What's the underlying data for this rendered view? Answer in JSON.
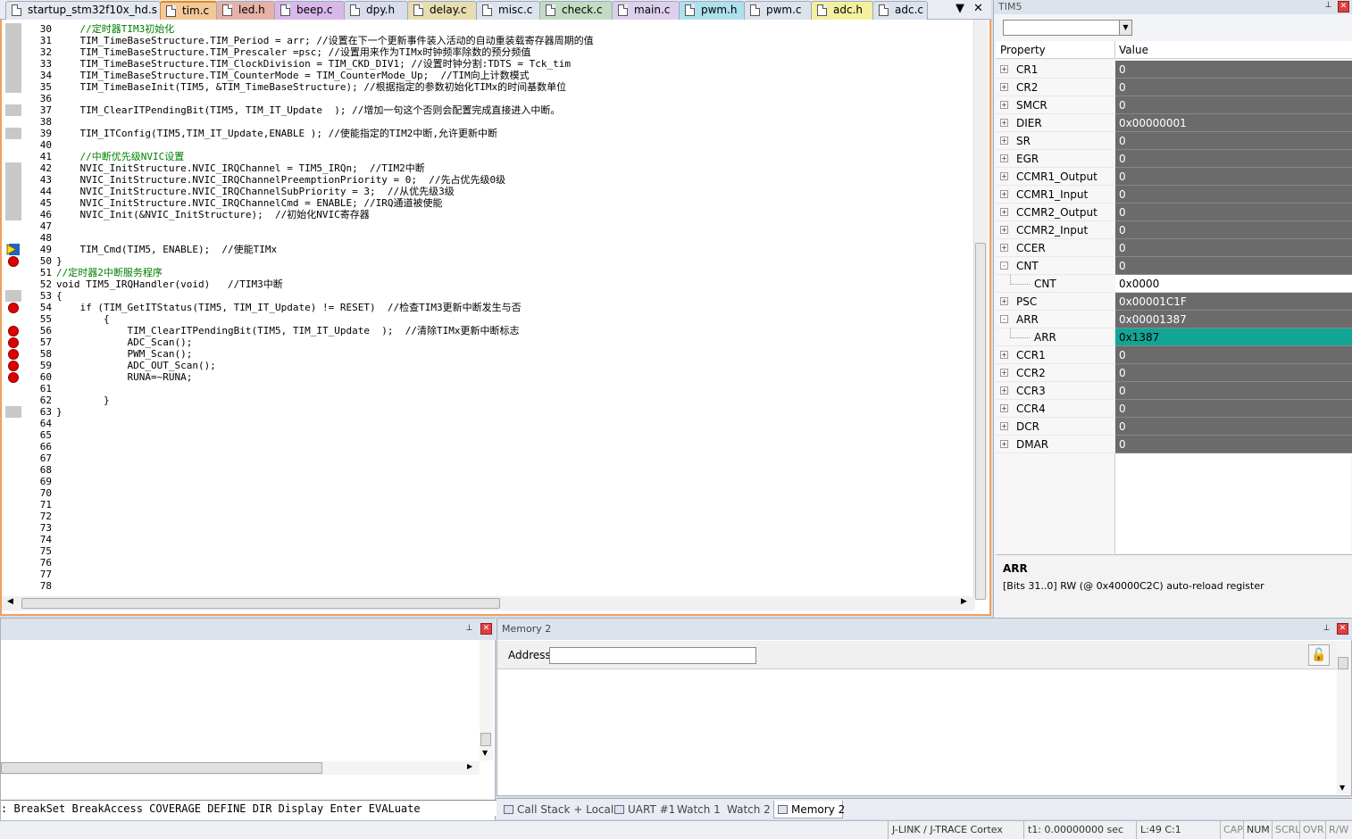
{
  "tabs": [
    {
      "label": "startup_stm32f10x_hd.s",
      "color": "#e4e9f0"
    },
    {
      "label": "tim.c",
      "color": "#f2c89a",
      "active": true
    },
    {
      "label": "led.h",
      "color": "#e6b2a8"
    },
    {
      "label": "beep.c",
      "color": "#d8b8e8"
    },
    {
      "label": "dpy.h",
      "color": "#d8dcec"
    },
    {
      "label": "delay.c",
      "color": "#e8ddb0"
    },
    {
      "label": "misc.c",
      "color": "#dde3ec"
    },
    {
      "label": "check.c",
      "color": "#c2dcc4"
    },
    {
      "label": "main.c",
      "color": "#ddd0ec"
    },
    {
      "label": "pwm.h",
      "color": "#aee0ee"
    },
    {
      "label": "pwm.c",
      "color": "#dde3ec"
    },
    {
      "label": "adc.h",
      "color": "#f4f0a0"
    },
    {
      "label": "adc.c",
      "color": "#dde3ec"
    }
  ],
  "code_lines": [
    {
      "n": "30",
      "t": "    //定时器TIM3初始化",
      "style": "cm",
      "mark": "gray"
    },
    {
      "n": "31",
      "t": "    TIM_TimeBaseStructure.TIM_Period = arr; //设置在下一个更新事件装入活动的自动重装载寄存器周期的值",
      "mark": "gray"
    },
    {
      "n": "32",
      "t": "    TIM_TimeBaseStructure.TIM_Prescaler =psc; //设置用来作为TIMx时钟频率除数的预分频值",
      "mark": "gray"
    },
    {
      "n": "33",
      "t": "    TIM_TimeBaseStructure.TIM_ClockDivision = TIM_CKD_DIV1; //设置时钟分割:TDTS = Tck_tim",
      "mark": "gray"
    },
    {
      "n": "34",
      "t": "    TIM_TimeBaseStructure.TIM_CounterMode = TIM_CounterMode_Up;  //TIM向上计数模式",
      "mark": "gray"
    },
    {
      "n": "35",
      "t": "    TIM_TimeBaseInit(TIM5, &TIM_TimeBaseStructure); //根据指定的参数初始化TIMx的时间基数单位",
      "mark": "gray"
    },
    {
      "n": "36",
      "t": ""
    },
    {
      "n": "37",
      "t": "    TIM_ClearITPendingBit(TIM5, TIM_IT_Update  ); //增加一句这个否则会配置完成直接进入中断。",
      "mark": "gray"
    },
    {
      "n": "38",
      "t": ""
    },
    {
      "n": "39",
      "t": "    TIM_ITConfig(TIM5,TIM_IT_Update,ENABLE ); //使能指定的TIM2中断,允许更新中断",
      "mark": "gray"
    },
    {
      "n": "40",
      "t": ""
    },
    {
      "n": "41",
      "t": "    //中断优先级NVIC设置",
      "style": "cm"
    },
    {
      "n": "42",
      "t": "    NVIC_InitStructure.NVIC_IRQChannel = TIM5_IRQn;  //TIM2中断",
      "mark": "gray"
    },
    {
      "n": "43",
      "t": "    NVIC_InitStructure.NVIC_IRQChannelPreemptionPriority = 0;  //先占优先级0级",
      "mark": "gray"
    },
    {
      "n": "44",
      "t": "    NVIC_InitStructure.NVIC_IRQChannelSubPriority = 3;  //从优先级3级",
      "mark": "gray"
    },
    {
      "n": "45",
      "t": "    NVIC_InitStructure.NVIC_IRQChannelCmd = ENABLE; //IRQ通道被使能",
      "mark": "gray"
    },
    {
      "n": "46",
      "t": "    NVIC_Init(&NVIC_InitStructure);  //初始化NVIC寄存器",
      "mark": "gray"
    },
    {
      "n": "47",
      "t": ""
    },
    {
      "n": "48",
      "t": ""
    },
    {
      "n": "49",
      "t": "    TIM_Cmd(TIM5, ENABLE);  //使能TIMx",
      "mark": "arrow"
    },
    {
      "n": "50",
      "t": "}",
      "mark": "bp"
    },
    {
      "n": "51",
      "t": "//定时器2中断服务程序",
      "style": "cm"
    },
    {
      "n": "52",
      "t": "void TIM5_IRQHandler(void)   //TIM3中断"
    },
    {
      "n": "53",
      "t": "{",
      "mark": "gray"
    },
    {
      "n": "54",
      "t": "    if (TIM_GetITStatus(TIM5, TIM_IT_Update) != RESET)  //检查TIM3更新中断发生与否",
      "mark": "bp"
    },
    {
      "n": "55",
      "t": "        {"
    },
    {
      "n": "56",
      "t": "            TIM_ClearITPendingBit(TIM5, TIM_IT_Update  );  //清除TIMx更新中断标志",
      "mark": "bp"
    },
    {
      "n": "57",
      "t": "            ADC_Scan();",
      "mark": "bp"
    },
    {
      "n": "58",
      "t": "            PWM_Scan();",
      "mark": "bp"
    },
    {
      "n": "59",
      "t": "            ADC_OUT_Scan();",
      "mark": "bp"
    },
    {
      "n": "60",
      "t": "            RUNA=~RUNA;",
      "mark": "bp"
    },
    {
      "n": "61",
      "t": ""
    },
    {
      "n": "62",
      "t": "        }"
    },
    {
      "n": "63",
      "t": "}",
      "mark": "gray"
    },
    {
      "n": "64",
      "t": ""
    },
    {
      "n": "65",
      "t": ""
    },
    {
      "n": "66",
      "t": ""
    },
    {
      "n": "67",
      "t": ""
    },
    {
      "n": "68",
      "t": ""
    },
    {
      "n": "69",
      "t": ""
    },
    {
      "n": "70",
      "t": ""
    },
    {
      "n": "71",
      "t": ""
    },
    {
      "n": "72",
      "t": ""
    },
    {
      "n": "73",
      "t": ""
    },
    {
      "n": "74",
      "t": ""
    },
    {
      "n": "75",
      "t": ""
    },
    {
      "n": "76",
      "t": ""
    },
    {
      "n": "77",
      "t": ""
    },
    {
      "n": "78",
      "t": ""
    }
  ],
  "right_panel": {
    "title": "TIM5",
    "col_property": "Property",
    "col_value": "Value",
    "rows": [
      {
        "name": "CR1",
        "value": "0",
        "exp": "+"
      },
      {
        "name": "CR2",
        "value": "0",
        "exp": "+"
      },
      {
        "name": "SMCR",
        "value": "0",
        "exp": "+"
      },
      {
        "name": "DIER",
        "value": "0x00000001",
        "exp": "+"
      },
      {
        "name": "SR",
        "value": "0",
        "exp": "+"
      },
      {
        "name": "EGR",
        "value": "0",
        "exp": "+"
      },
      {
        "name": "CCMR1_Output",
        "value": "0",
        "exp": "+"
      },
      {
        "name": "CCMR1_Input",
        "value": "0",
        "exp": "+"
      },
      {
        "name": "CCMR2_Output",
        "value": "0",
        "exp": "+"
      },
      {
        "name": "CCMR2_Input",
        "value": "0",
        "exp": "+"
      },
      {
        "name": "CCER",
        "value": "0",
        "exp": "+"
      },
      {
        "name": "CNT",
        "value": "0",
        "exp": "−"
      },
      {
        "name": "CNT",
        "value": "0x0000",
        "child": true,
        "vstyle": "white"
      },
      {
        "name": "PSC",
        "value": "0x00001C1F",
        "exp": "+"
      },
      {
        "name": "ARR",
        "value": "0x00001387",
        "exp": "−"
      },
      {
        "name": "ARR",
        "value": "0x1387",
        "child": true,
        "vstyle": "teal"
      },
      {
        "name": "CCR1",
        "value": "0",
        "exp": "+"
      },
      {
        "name": "CCR2",
        "value": "0",
        "exp": "+"
      },
      {
        "name": "CCR3",
        "value": "0",
        "exp": "+"
      },
      {
        "name": "CCR4",
        "value": "0",
        "exp": "+"
      },
      {
        "name": "DCR",
        "value": "0",
        "exp": "+"
      },
      {
        "name": "DMAR",
        "value": "0",
        "exp": "+"
      }
    ],
    "desc_title": "ARR",
    "desc_text": "[Bits 31..0] RW (@ 0x40000C2C) auto-reload register"
  },
  "command": {
    "text": ": BreakSet BreakAccess COVERAGE DEFINE DIR Display Enter EVALuate"
  },
  "memory": {
    "title": "Memory 2",
    "address_label": "Address:",
    "address_value": ""
  },
  "bottom_tabs": [
    {
      "label": "Call Stack + Locals"
    },
    {
      "label": "UART #1"
    },
    {
      "label": "Watch 1"
    },
    {
      "label": "Watch 2"
    },
    {
      "label": "Memory 2",
      "active": true
    }
  ],
  "status": {
    "debugger": "J-LINK / J-TRACE Cortex",
    "time": "t1: 0.00000000 sec",
    "pos": "L:49 C:1",
    "cap": "CAP",
    "num": "NUM",
    "scrl": "SCRL",
    "ovr": "OVR",
    "rw": "R/W"
  },
  "icons": {
    "pin": "pin-icon",
    "close": "close-icon",
    "dropdown": "chevron-down-icon",
    "lock": "lock-icon"
  }
}
